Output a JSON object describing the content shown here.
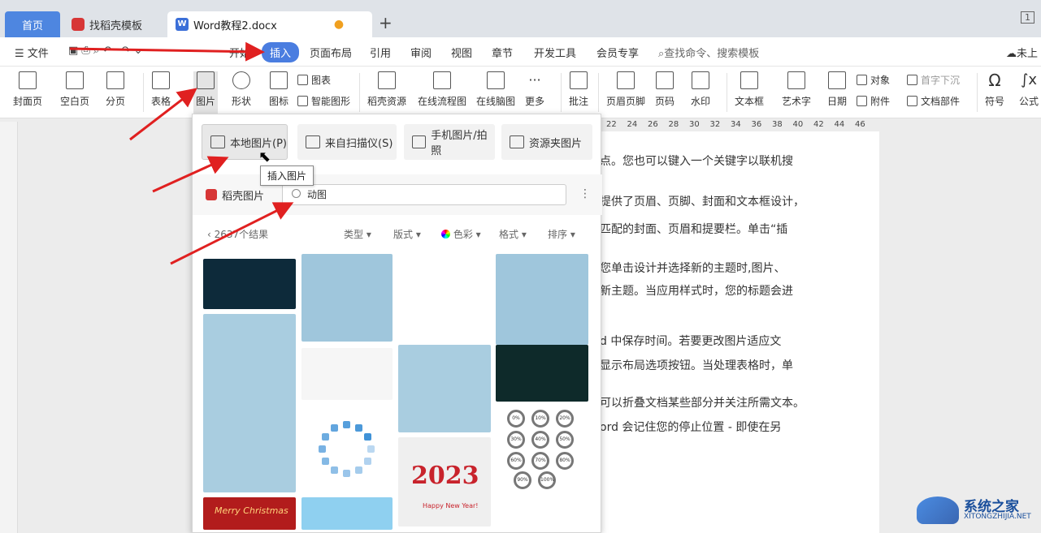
{
  "tabs": {
    "home": "首页",
    "template": "找稻壳模板",
    "doc": "Word教程2.docx",
    "plus": "+",
    "window_badge": "1"
  },
  "menu": {
    "file": "文件",
    "start": "开始",
    "insert": "插入",
    "layout": "页面布局",
    "ref": "引用",
    "review": "审阅",
    "view": "视图",
    "chapter": "章节",
    "dev": "开发工具",
    "member": "会员专享",
    "search": "查找命令、搜索模板",
    "cloud": "未上"
  },
  "ribbon": {
    "cover": "封面页",
    "blank": "空白页",
    "pagebreak": "分页",
    "table": "表格",
    "picture": "图片",
    "shape": "形状",
    "icon": "图标",
    "chart": "图表",
    "smart": "智能图形",
    "daoke": "稻壳资源",
    "flow": "在线流程图",
    "mind": "在线脑图",
    "more": "更多",
    "comment": "批注",
    "header": "页眉页脚",
    "pagenum": "页码",
    "watermark": "水印",
    "textbox": "文本框",
    "art": "艺术字",
    "date": "日期",
    "object": "对象",
    "attach": "附件",
    "dropcap": "首字下沉",
    "docpart": "文档部件",
    "symbol": "符号",
    "formula": "公式"
  },
  "ruler": {
    "ticks": [
      "22",
      "24",
      "26",
      "28",
      "30",
      "32",
      "34",
      "36",
      "38",
      "40",
      "42",
      "44",
      "46"
    ]
  },
  "doc_lines": [
    "点。您也可以键入一个关键字以联机搜",
    "提供了页眉、页脚、封面和文本框设计，",
    "匹配的封面、页眉和提要栏。单击“插",
    "您单击设计并选择新的主题时,图片、",
    "新主题。当应用样式时，您的标题会进",
    "d 中保存时间。若要更改图片适应文",
    "显示布局选项按钮。当处理表格时，单",
    "可以折叠文档某些部分并关注所需文本。",
    "ord 会记住您的停止位置 - 即使在另"
  ],
  "panel": {
    "local": "本地图片(P)",
    "scan": "来自扫描仪(S)",
    "phone": "手机图片/拍照",
    "resource": "资源夹图片",
    "tooltip": "插入图片",
    "daoke_title": "稻壳图片",
    "search_value": "动图",
    "more": "⋮",
    "results": "2637个结果",
    "filter_type": "类型",
    "filter_layout": "版式",
    "filter_color": "色彩",
    "filter_format": "格式",
    "filter_sort": "排序",
    "thumb_text_2023": "2023",
    "thumb_text_xmas": "Merry Christmas",
    "thumb_text_newyear": "Happy New Year!",
    "pct": [
      "0%",
      "10%",
      "20%",
      "30%",
      "40%",
      "50%",
      "60%",
      "70%",
      "80%",
      "90%",
      "100%"
    ]
  },
  "watermark": {
    "name": "系统之家",
    "url": "XITONGZHIJIA.NET"
  },
  "colors": {
    "accent": "#4a7de0",
    "arrow": "#e02020",
    "tab_home": "#4e86e0"
  }
}
